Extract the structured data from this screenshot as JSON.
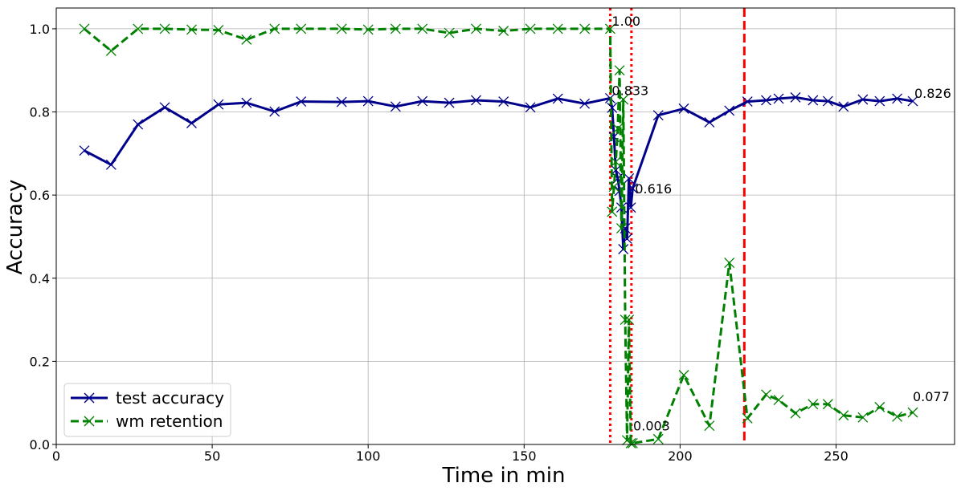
{
  "chart_data": {
    "type": "line",
    "title": "",
    "xlabel": "Time in min",
    "ylabel": "Accuracy",
    "xlim": [
      0,
      288
    ],
    "ylim": [
      0,
      1.05
    ],
    "x_ticks": [
      0,
      50,
      100,
      150,
      200,
      250
    ],
    "x_tick_labels": [
      "0",
      "50",
      "100",
      "150",
      "200",
      "250"
    ],
    "y_ticks": [
      0.0,
      0.2,
      0.4,
      0.6,
      0.8,
      1.0
    ],
    "y_tick_labels": [
      "0.0",
      "0.2",
      "0.4",
      "0.6",
      "0.8",
      "1.0"
    ],
    "grid": true,
    "legend_position": "bottom-left",
    "series": [
      {
        "name": "test accuracy",
        "color": "#00008b",
        "line_style": "solid",
        "marker": "x",
        "points": [
          [
            9,
            0.707
          ],
          [
            17.6,
            0.673
          ],
          [
            26.2,
            0.77
          ],
          [
            34.8,
            0.811
          ],
          [
            43.4,
            0.773
          ],
          [
            52,
            0.818
          ],
          [
            61,
            0.822
          ],
          [
            70,
            0.801
          ],
          [
            78.5,
            0.825
          ],
          [
            91.5,
            0.824
          ],
          [
            100,
            0.826
          ],
          [
            108.8,
            0.813
          ],
          [
            117.4,
            0.826
          ],
          [
            126,
            0.822
          ],
          [
            134.6,
            0.828
          ],
          [
            143.4,
            0.825
          ],
          [
            152,
            0.811
          ],
          [
            160.8,
            0.832
          ],
          [
            169.4,
            0.82
          ],
          [
            177.6,
            0.833
          ],
          [
            178.2,
            0.81
          ],
          [
            178.8,
            0.74
          ],
          [
            179.4,
            0.66
          ],
          [
            180,
            0.64
          ],
          [
            180.6,
            0.61
          ],
          [
            181.2,
            0.57
          ],
          [
            181.8,
            0.47
          ],
          [
            182.4,
            0.52
          ],
          [
            183,
            0.495
          ],
          [
            183.6,
            0.64
          ],
          [
            184.2,
            0.57
          ],
          [
            184.8,
            0.616
          ],
          [
            193,
            0.792
          ],
          [
            201.2,
            0.808
          ],
          [
            209.4,
            0.775
          ],
          [
            215.8,
            0.803
          ],
          [
            221.6,
            0.825
          ],
          [
            227.6,
            0.828
          ],
          [
            231.6,
            0.832
          ],
          [
            237,
            0.835
          ],
          [
            242.6,
            0.828
          ],
          [
            247.4,
            0.826
          ],
          [
            252.4,
            0.813
          ],
          [
            258.6,
            0.83
          ],
          [
            264,
            0.826
          ],
          [
            269.6,
            0.832
          ],
          [
            274.6,
            0.826
          ]
        ]
      },
      {
        "name": "wm retention",
        "color": "#008000",
        "line_style": "dashed",
        "marker": "x",
        "points": [
          [
            9,
            1.0
          ],
          [
            17.6,
            0.947
          ],
          [
            26.2,
            1.0
          ],
          [
            34.8,
            1.0
          ],
          [
            43.4,
            0.998
          ],
          [
            52,
            0.997
          ],
          [
            61,
            0.974
          ],
          [
            70,
            1.0
          ],
          [
            78.5,
            1.0
          ],
          [
            91.5,
            1.0
          ],
          [
            100,
            0.998
          ],
          [
            108.8,
            1.0
          ],
          [
            117.4,
            1.0
          ],
          [
            126,
            0.99
          ],
          [
            134.6,
            1.0
          ],
          [
            143.4,
            0.995
          ],
          [
            152,
            1.0
          ],
          [
            160.8,
            1.0
          ],
          [
            169.4,
            1.0
          ],
          [
            177.6,
            1.0
          ],
          [
            178.2,
            0.56
          ],
          [
            178.8,
            0.62
          ],
          [
            179.4,
            0.68
          ],
          [
            180,
            0.76
          ],
          [
            180.6,
            0.9
          ],
          [
            181.2,
            0.52
          ],
          [
            181.8,
            0.83
          ],
          [
            182.4,
            0.3
          ],
          [
            183,
            0.01
          ],
          [
            183.6,
            0.3
          ],
          [
            184.2,
            0.003
          ],
          [
            184.8,
            0.003
          ],
          [
            193,
            0.013
          ],
          [
            201.2,
            0.167
          ],
          [
            209.4,
            0.045
          ],
          [
            215.8,
            0.437
          ],
          [
            221.6,
            0.063
          ],
          [
            227.6,
            0.12
          ],
          [
            231.6,
            0.107
          ],
          [
            237,
            0.075
          ],
          [
            242.6,
            0.097
          ],
          [
            247.4,
            0.097
          ],
          [
            252.4,
            0.07
          ],
          [
            258.6,
            0.065
          ],
          [
            264,
            0.09
          ],
          [
            269.6,
            0.067
          ],
          [
            274.6,
            0.077
          ]
        ]
      }
    ],
    "vertical_lines": [
      {
        "x": 177.6,
        "color": "#ff0000",
        "style": "dotted"
      },
      {
        "x": 184.4,
        "color": "#ff0000",
        "style": "dotted"
      },
      {
        "x": 220.6,
        "color": "#ff0000",
        "style": "dashed"
      }
    ],
    "annotations": [
      {
        "text": "1.00",
        "x": 177.6,
        "y": 1.0,
        "anchor": "top"
      },
      {
        "text": "0.833",
        "x": 177.6,
        "y": 0.833,
        "anchor": "top"
      },
      {
        "text": "0.616",
        "x": 184.8,
        "y": 0.616,
        "anchor": "right"
      },
      {
        "text": "0.003",
        "x": 184.2,
        "y": 0.003,
        "anchor": "top-right"
      },
      {
        "text": "0.826",
        "x": 274.6,
        "y": 0.826,
        "anchor": "top"
      },
      {
        "text": "0.077",
        "x": 274.6,
        "y": 0.077,
        "anchor": "above"
      }
    ]
  }
}
